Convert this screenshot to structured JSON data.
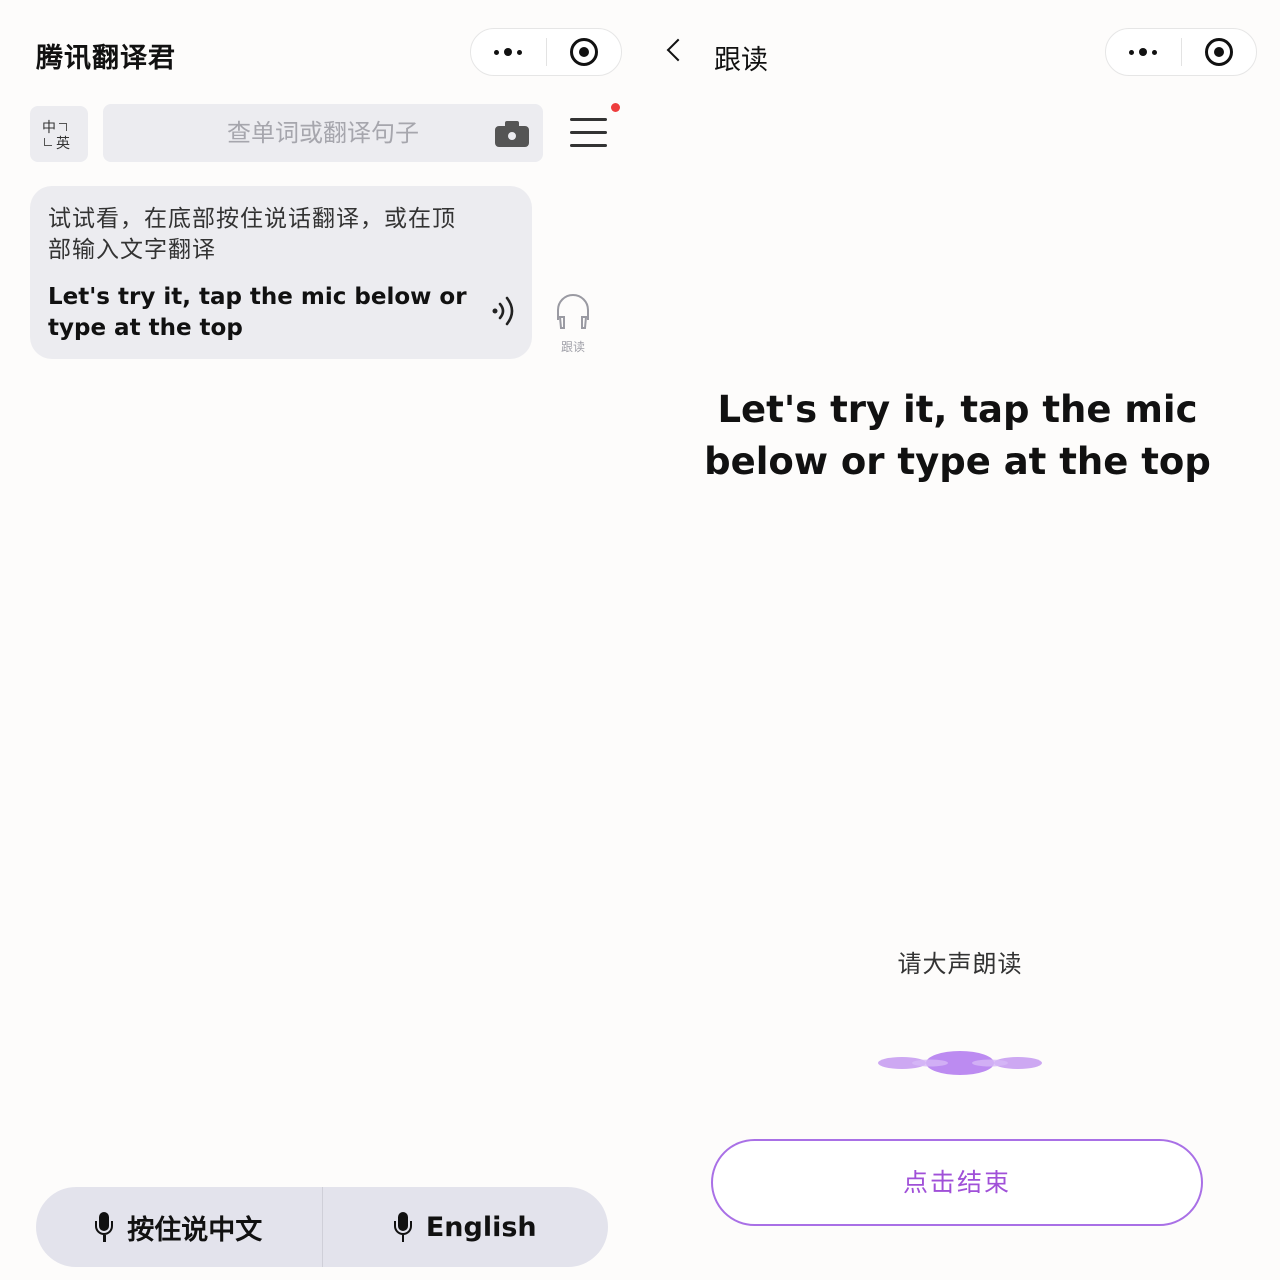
{
  "left": {
    "app_title": "腾讯翻译君",
    "lang_toggle": {
      "zh": "中",
      "en": "英"
    },
    "search": {
      "placeholder": "查单词或翻译句子"
    },
    "card": {
      "source_text": "试试看，在底部按住说话翻译，或在顶部输入文字翻译",
      "translation": "Let's try it, tap the mic below or type at the top"
    },
    "follow_read_label": "跟读",
    "mic_bar": {
      "chinese_label": "按住说中文",
      "english_label": "English"
    },
    "notification_dot_color": "#ee3d3d"
  },
  "right": {
    "title": "跟读",
    "sentence": "Let's try it, tap the mic below or type at the top",
    "prompt": "请大声朗读",
    "end_button": "点击结束",
    "accent_color": "#a970e6"
  }
}
